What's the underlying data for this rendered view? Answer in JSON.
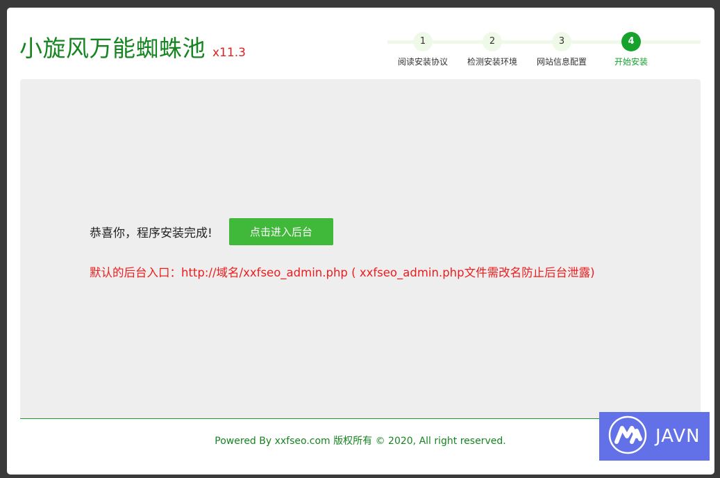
{
  "brand": {
    "name": "小旋风万能蜘蛛池",
    "version": "x11.3"
  },
  "steps": [
    {
      "number": "1",
      "label": "阅读安装协议"
    },
    {
      "number": "2",
      "label": "检测安装环境"
    },
    {
      "number": "3",
      "label": "网站信息配置"
    },
    {
      "number": "4",
      "label": "开始安装"
    }
  ],
  "active_step": 4,
  "main": {
    "success_message": "恭喜你，程序安装完成!",
    "enter_button": "点击进入后台",
    "admin_note": "默认的后台入口：http://域名/xxfseo_admin.php ( xxfseo_admin.php文件需改名防止后台泄露)"
  },
  "footer": {
    "text": "Powered By xxfseo.com 版权所有 © 2020, All right reserved."
  },
  "watermark": {
    "text": "JAVN",
    "icon": "m-logo-icon"
  },
  "colors": {
    "brand_green": "#15851f",
    "accent_green": "#40b83a",
    "alert_red": "#ee1c1c",
    "badge_blue": "#6371e8"
  }
}
